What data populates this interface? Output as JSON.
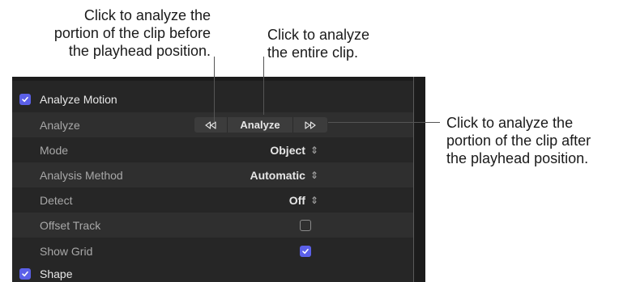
{
  "callouts": {
    "before": "Click to analyze the\nportion of the clip before\nthe playhead position.",
    "entire": "Click to analyze\nthe entire clip.",
    "after": "Click to analyze the\nportion of the clip after\nthe playhead position."
  },
  "panel": {
    "section_title": "Analyze Motion",
    "analyze_label": "Analyze",
    "analyze_button": "Analyze",
    "rows": {
      "mode": {
        "label": "Mode",
        "value": "Object"
      },
      "method": {
        "label": "Analysis Method",
        "value": "Automatic"
      },
      "detect": {
        "label": "Detect",
        "value": "Off"
      },
      "offset": {
        "label": "Offset Track",
        "checked": false
      },
      "grid": {
        "label": "Show Grid",
        "checked": true
      }
    },
    "shape_title": "Shape"
  },
  "icons": {
    "rewind": "rewind-icon",
    "forward": "fast-forward-icon",
    "updown": "up-down-chevron-icon",
    "check": "checkmark-icon"
  },
  "colors": {
    "accent": "#5b60e8",
    "panel_bg": "#262626"
  }
}
